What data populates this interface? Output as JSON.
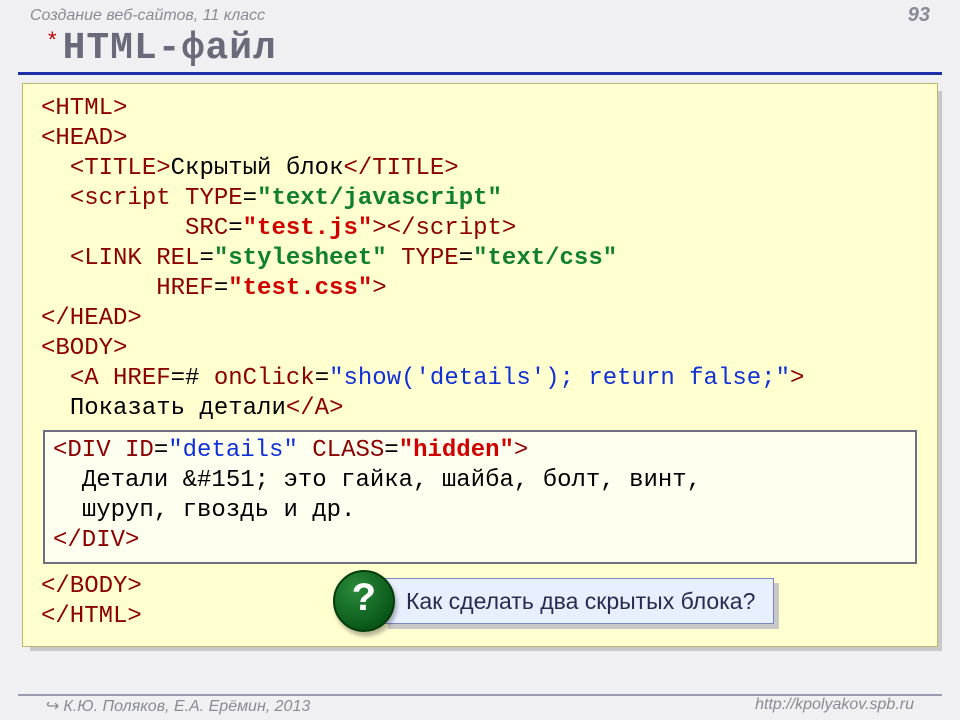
{
  "header": {
    "course": "Создание веб-сайтов, 11 класс",
    "page": "93"
  },
  "title": {
    "asterisk": "*",
    "text": "HTML-файл"
  },
  "code": {
    "html_open": "<HTML>",
    "head_open": "<HEAD>",
    "title_open": "<TITLE>",
    "title_text": "Скрытый блок",
    "title_close": "</TITLE>",
    "script_open_tag": "<script",
    "script_type_attr": "TYPE",
    "script_type_val": "\"text/javascript\"",
    "script_src_attr": "SRC",
    "script_src_val": "\"test.js\"",
    "script_close_inline": "></scr",
    "script_close_inline2": "ipt>",
    "link_tag": "<LINK",
    "link_rel_attr": "REL",
    "link_rel_val": "\"stylesheet\"",
    "link_type_attr": "TYPE",
    "link_type_val": "\"text/css\"",
    "link_href_attr": "HREF",
    "link_href_val": "\"test.css\"",
    "link_close": ">",
    "head_close": "</HEAD>",
    "body_open": "<BODY>",
    "a_open": "<A",
    "a_href_attr": "HREF",
    "a_href_val": "#",
    "a_onclick_attr": "onClick",
    "a_onclick_val": "\"show('details'); return false;\"",
    "a_close_bracket": ">",
    "a_text": "Показать детали",
    "a_close": "</A>",
    "body_close": "</BODY>",
    "html_close": "</HTML>"
  },
  "inner": {
    "div_open": "<DIV",
    "id_attr": "ID",
    "id_val": "\"details\"",
    "class_attr": "CLASS",
    "class_val": "\"hidden\"",
    "close_bracket": ">",
    "content_line1": "Детали &#151; это гайка, шайба, болт, винт,",
    "content_line2": "шуруп, гвоздь и др.",
    "div_close": "</DIV>"
  },
  "question": {
    "mark": "?",
    "text": "Как сделать два скрытых блока?"
  },
  "footer": {
    "author": "К.Ю. Поляков, Е.А. Ерёмин, 2013",
    "url": "http://kpolyakov.spb.ru"
  }
}
